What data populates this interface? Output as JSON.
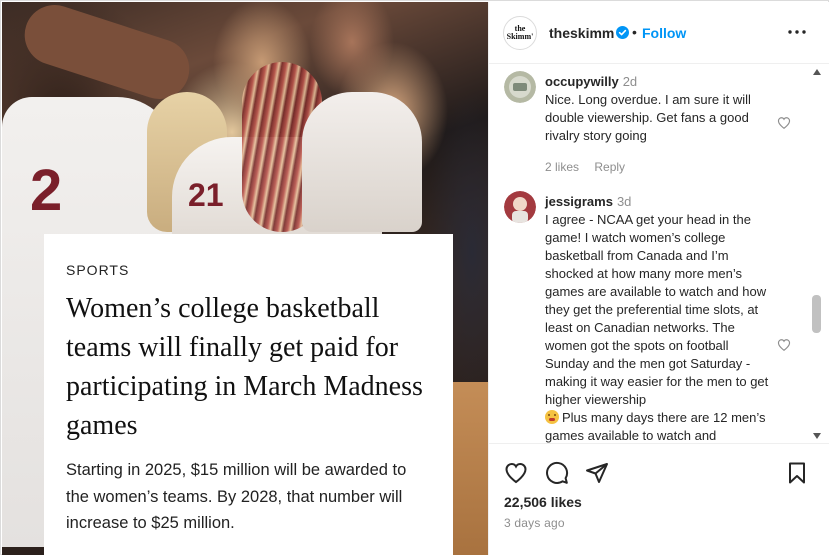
{
  "post": {
    "kicker": "SPORTS",
    "headline": "Women’s college basketball teams will finally get paid for participating in March Madness games",
    "dek": "Starting in 2025, $15 million will be awarded to the women’s teams. By 2028, that number will increase to $25 million.",
    "jersey_numbers": {
      "left": "2",
      "middle": "21"
    }
  },
  "header": {
    "avatar_text": "the Skimm'",
    "username": "theskimm",
    "separator": "•",
    "follow_label": "Follow",
    "accent": "#0095f6",
    "verified_color": "#0095f6"
  },
  "comments": [
    {
      "username": "occupywilly",
      "time": "2d",
      "text": "Nice. Long overdue. I am sure it will double viewership. Get fans a good rivalry story going",
      "likes": "2 likes",
      "reply": "Reply"
    },
    {
      "username": "jessigrams",
      "time": "3d",
      "text": "I agree - NCAA get your head in the game! I watch women’s college basketball from Canada and I’m shocked at how many more men’s games are available to watch and how they get the preferential time slots, at least on Canadian networks. The women got the spots on football Sunday and the men got Saturday - making it way easier for the men to get higher viewership",
      "text_tail": "Plus many days there are 12 men’s games available to watch and"
    }
  ],
  "footer": {
    "likes": "22,506 likes",
    "time": "3 days ago"
  }
}
